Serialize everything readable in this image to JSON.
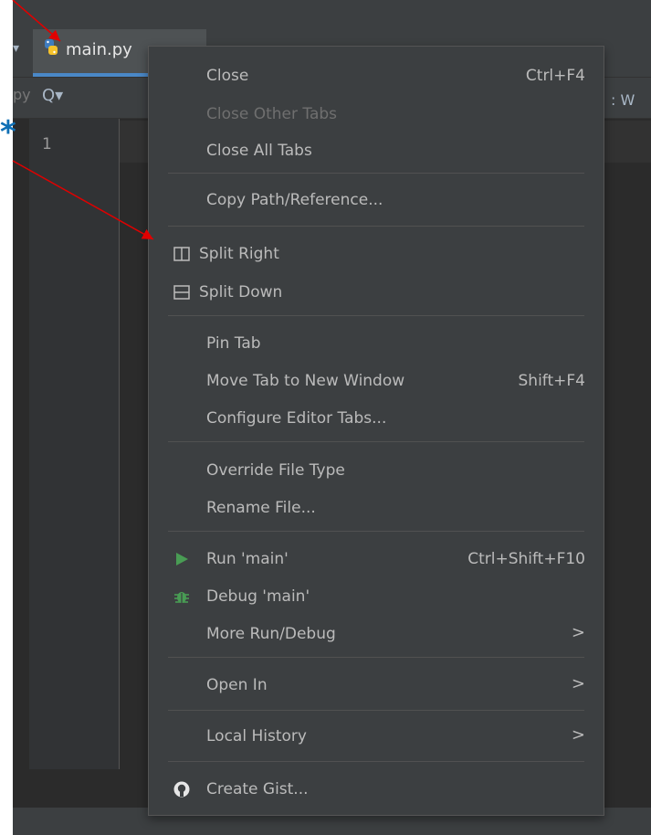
{
  "tab": {
    "file_name": "main.py"
  },
  "toolbar": {
    "left_text": "py",
    "right_text": ": W"
  },
  "gutter": {
    "line_number": "1"
  },
  "annotation": {
    "star": "*"
  },
  "menu": {
    "close": {
      "label": "Close",
      "shortcut": "Ctrl+F4"
    },
    "close_other": {
      "label": "Close Other Tabs"
    },
    "close_all": {
      "label": "Close All Tabs"
    },
    "copy_path": {
      "label": "Copy Path/Reference..."
    },
    "split_right": {
      "label": "Split Right"
    },
    "split_down": {
      "label": "Split Down"
    },
    "pin_tab": {
      "label": "Pin Tab"
    },
    "move_tab": {
      "label": "Move Tab to New Window",
      "shortcut": "Shift+F4"
    },
    "configure_tabs": {
      "label": "Configure Editor Tabs..."
    },
    "override_type": {
      "label": "Override File Type"
    },
    "rename_file": {
      "label": "Rename File..."
    },
    "run": {
      "label": "Run 'main'",
      "shortcut": "Ctrl+Shift+F10"
    },
    "debug": {
      "label": "Debug 'main'"
    },
    "more_run": {
      "label": "More Run/Debug",
      "submenu": ">"
    },
    "open_in": {
      "label": "Open In",
      "submenu": ">"
    },
    "local_history": {
      "label": "Local History",
      "submenu": ">"
    },
    "create_gist": {
      "label": "Create Gist..."
    }
  },
  "colors": {
    "menu_bg": "#3c3f41",
    "menu_text": "#bbbbbb",
    "disabled_text": "#6f6f6f",
    "run_icon": "#499c54",
    "debug_icon": "#499c54",
    "tab_underline": "#4a88c7",
    "annotation_arrow": "#e00000",
    "annotation_star": "#0e6fb5"
  },
  "icons": {
    "tab": "python-file-icon",
    "split_right": "split-vertical-icon",
    "split_down": "split-horizontal-icon",
    "run": "play-icon",
    "debug": "bug-icon",
    "gist": "github-icon"
  }
}
